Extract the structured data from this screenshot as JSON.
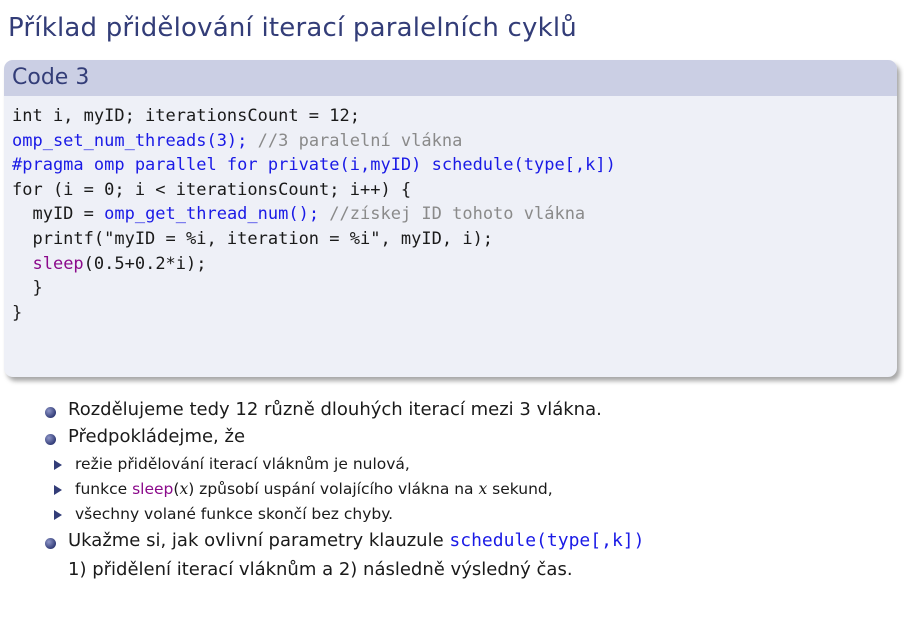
{
  "slide": {
    "title": "Příklad přidělování iterací paralelních cyklů"
  },
  "code_block": {
    "title": "Code 3",
    "lines": [
      {
        "plain": "int i, myID; iterationsCount = 12;"
      },
      {
        "call": "omp_set_num_threads(3);",
        "comment": " //3 paralelní vlákna"
      },
      {
        "pragma": "#pragma omp parallel for private(i,myID) schedule(type[,k])"
      },
      {
        "plain": "for (i = 0; i < iterationsCount; i++) {"
      },
      {
        "indent": "  myID = ",
        "call": "omp_get_thread_num();",
        "comment": " //získej ID tohoto vlákna"
      },
      {
        "plain": "  printf(\"myID = %i, iteration = %i\", myID, i);"
      },
      {
        "indent": "  ",
        "sleep": "sleep",
        "rest": "(0.5+0.2*i);"
      },
      {
        "plain": "  }"
      },
      {
        "plain": "}"
      }
    ]
  },
  "bullets": {
    "b1": "Rozdělujeme tedy 12 různě dlouhých iterací mezi 3 vlákna.",
    "b2": "Předpokládejme, že",
    "sub1": "režie přidělování iterací vláknům je nulová,",
    "sub2_pre": "funkce ",
    "sub2_func": "sleep",
    "sub2_arg_open": "(",
    "sub2_var": "x",
    "sub2_arg_close": ")",
    "sub2_mid": " způsobí uspání volajícího vlákna na ",
    "sub2_var2": "x",
    "sub2_post": " sekund,",
    "sub3": "všechny volané funkce skončí bez chyby.",
    "b3_pre": "Ukažme si, jak ovlivní parametry klauzule ",
    "b3_code": "schedule(type[,k])",
    "b3_cont": "1) přidělení iterací vláknům a 2) následně výsledný čas."
  },
  "colors": {
    "title": "#333d78",
    "block_header": "#cbcfe4",
    "block_body": "#eef0f7",
    "keyword_blue": "#1a1ae6",
    "comment_gray": "#8a8a8a",
    "sleep_purple": "#8b0a8b"
  }
}
